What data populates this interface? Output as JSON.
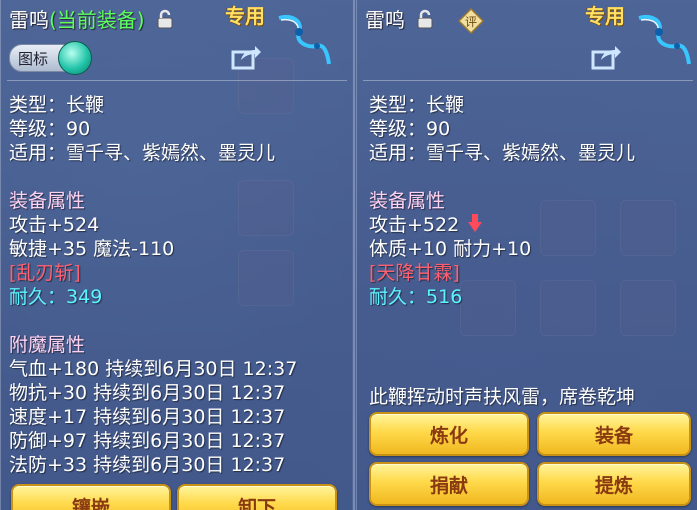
{
  "left": {
    "title_name": "雷鸣",
    "title_status": "(当前装备)",
    "special_badge": "专用",
    "toggle_label": "图标",
    "type_line": "类型：长鞭",
    "level_line": "等级：90",
    "use_line": "适用：雪千寻、紫嫣然、墨灵儿",
    "attr_title": "装备属性",
    "attrs": [
      "攻击+524",
      "敏捷+35 魔法-110"
    ],
    "skill": "[乱刃斩]",
    "durability_label": "耐久：",
    "durability_value": "349",
    "enchant_title": "附魔属性",
    "enchants": [
      "气血+180 持续到6月30日 12:37",
      "物抗+30 持续到6月30日 12:37",
      "速度+17 持续到6月30日 12:37",
      "防御+97 持续到6月30日 12:37",
      "法防+33 持续到6月30日 12:37"
    ],
    "buttons": [
      "镶嵌",
      "卸下"
    ]
  },
  "right": {
    "title_name": "雷鸣",
    "review_label": "评",
    "special_badge": "专用",
    "type_line": "类型：长鞭",
    "level_line": "等级：90",
    "use_line": "适用：雪千寻、紫嫣然、墨灵儿",
    "attr_title": "装备属性",
    "attrs": [
      "攻击+522",
      "体质+10 耐力+10"
    ],
    "skill": "[天降甘霖]",
    "durability_label": "耐久：",
    "durability_value": "516",
    "description": "此鞭挥动时声扶风雷，席卷乾坤",
    "buttons": [
      "炼化",
      "装备",
      "捐献",
      "提炼"
    ]
  },
  "colors": {
    "gold_button": "#ffd94a",
    "section_pink": "#ffd2f2",
    "skill_red": "#ff6070",
    "durability_cyan": "#5cf4ff",
    "current_green": "#5cff5c"
  },
  "icons": [
    "lock-icon",
    "share-icon",
    "weapon-whip-icon",
    "review-icon",
    "down-arrow-icon",
    "toggle-knob-icon"
  ]
}
